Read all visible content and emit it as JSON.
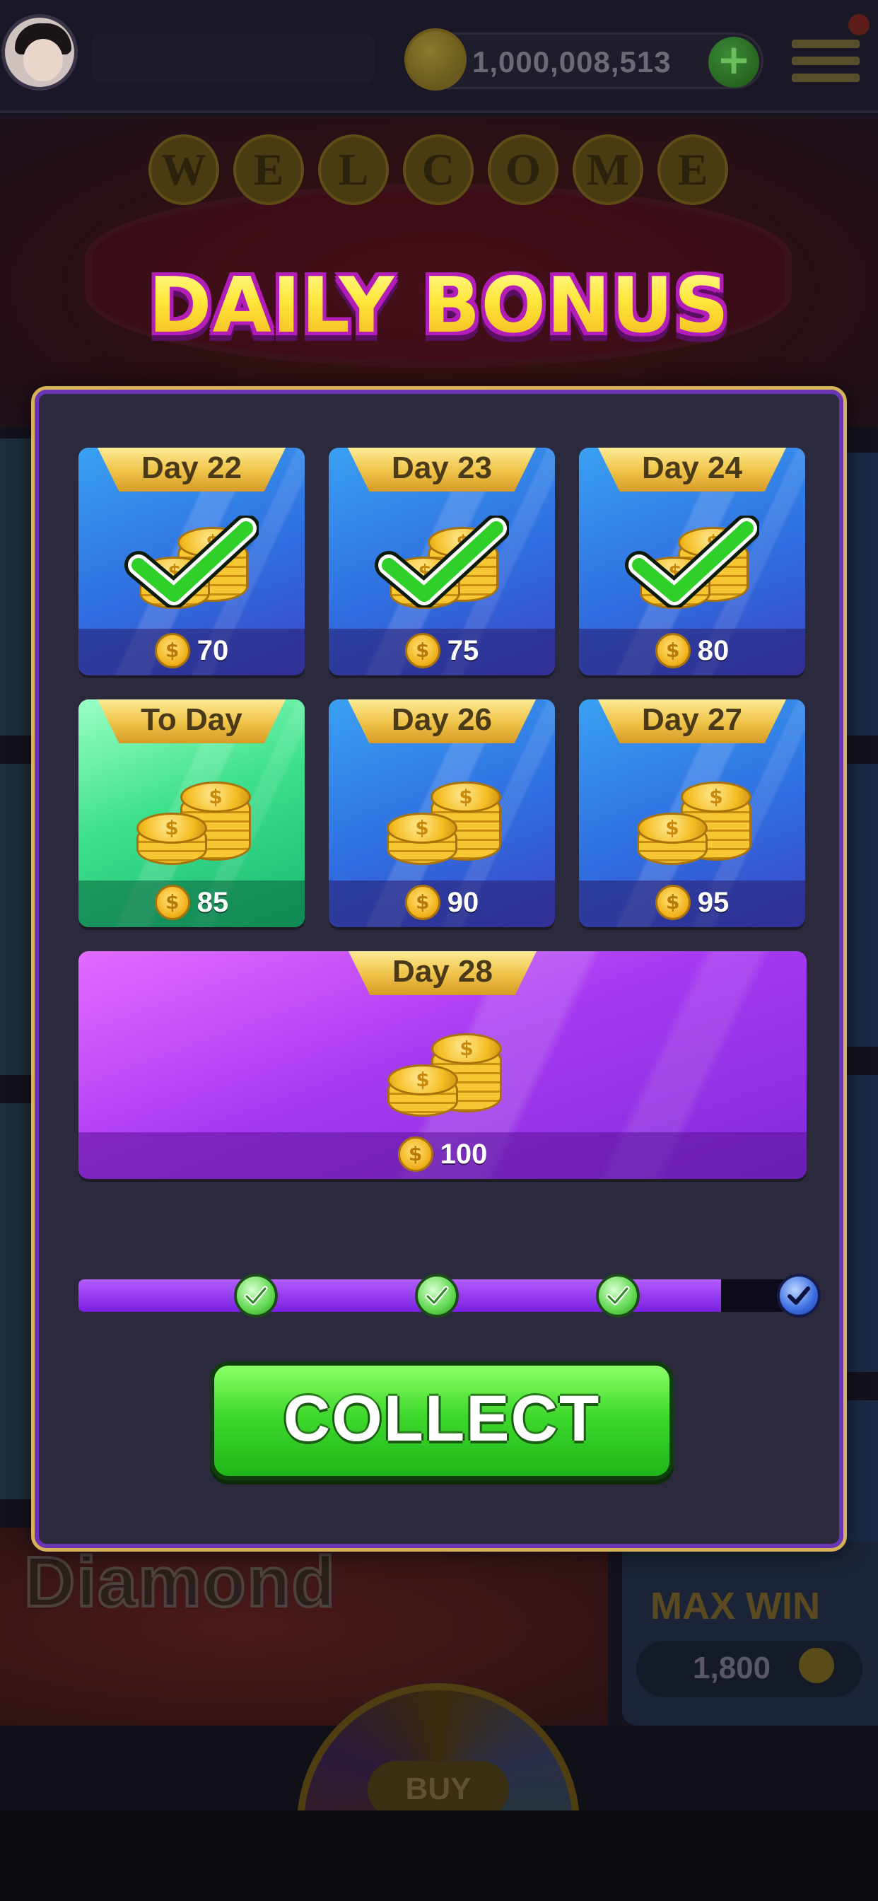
{
  "header": {
    "coin_balance": "1,000,008,513",
    "add_coins_label": "+",
    "menu_icon": "menu-icon",
    "avatar_icon": "avatar-icon"
  },
  "background": {
    "welcome_letters": [
      "W",
      "E",
      "L",
      "C",
      "O",
      "M",
      "E"
    ],
    "brand_partial": "Diamond",
    "max_win_label": "MAX WIN",
    "max_win_value": "1,800",
    "buy_label": "BUY"
  },
  "modal": {
    "title": "DAILY BONUS",
    "days": [
      {
        "label": "Day 22",
        "reward": "70",
        "state": "claimed"
      },
      {
        "label": "Day 23",
        "reward": "75",
        "state": "claimed"
      },
      {
        "label": "Day 24",
        "reward": "80",
        "state": "claimed"
      },
      {
        "label": "To Day",
        "reward": "85",
        "state": "today"
      },
      {
        "label": "Day 26",
        "reward": "90",
        "state": "locked"
      },
      {
        "label": "Day 27",
        "reward": "95",
        "state": "locked"
      }
    ],
    "grand": {
      "label": "Day 28",
      "reward": "100"
    },
    "progress": {
      "fraction": 0.9,
      "milestones_done": 3,
      "milestones_total": 4
    },
    "collect_label": "COLLECT"
  },
  "colors": {
    "accent_gold": "#f0c44a",
    "collect_green": "#3fd92c",
    "modal_border": "#d8b25a",
    "progress_purple": "#9b3bf0"
  }
}
